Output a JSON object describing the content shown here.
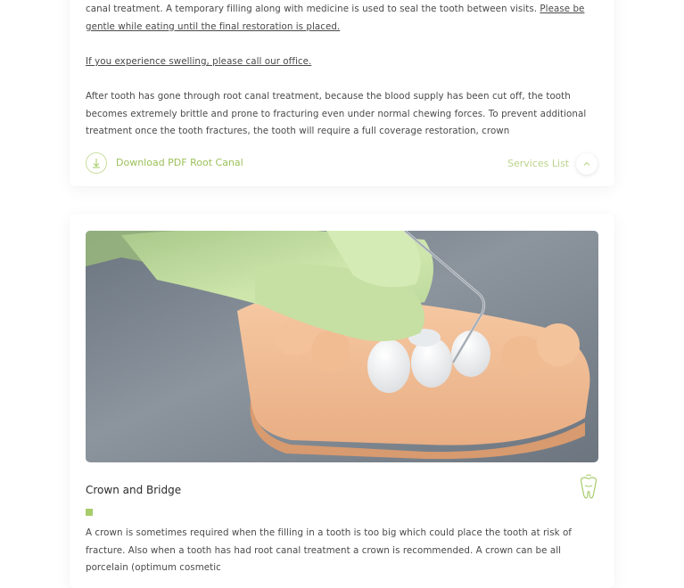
{
  "section_root_canal": {
    "paragraph1": {
      "text": "canal treatment. A temporary filling along with medicine is used to seal the tooth between visits. ",
      "link": "Please be gentle while eating until the final restoration is placed."
    },
    "paragraph2_link": "If you experience swelling, please call our office.",
    "paragraph3": "After tooth has gone through root canal treatment, because the blood supply has been cut off, the tooth becomes extremely brittle and prone to fracturing even under normal chewing forces. To prevent additional treatment once the tooth fractures, the tooth will require a full coverage restoration, crown",
    "download_label": "Download PDF Root Canal",
    "services_list_label": "Services List",
    "icons": {
      "download": "download-arrow-icon",
      "up": "chevron-up-icon"
    }
  },
  "section_crown_bridge": {
    "image_alt": "Gloved hand holding dental probe over tooth model with crowns",
    "title": "Crown and Bridge",
    "icon": "tooth-icon",
    "paragraph": "A crown is sometimes required when the filling in a tooth is too big which could place the tooth at risk of fracture. Also when a tooth has had root canal treatment a crown is recommended. A crown can be all porcelain (optimum cosmetic"
  },
  "colors": {
    "accent_green": "#a8cc6c",
    "link_green": "#9cc05a",
    "body_text": "#4a4a4a"
  }
}
